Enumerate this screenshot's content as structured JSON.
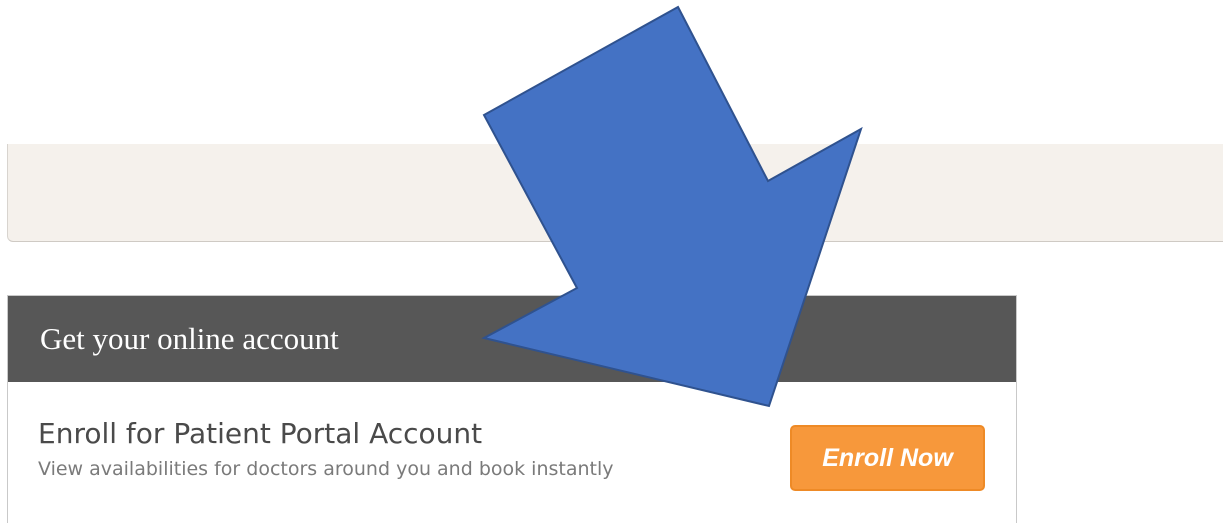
{
  "card": {
    "title": "Get your online account",
    "heading": "Enroll for Patient Portal Account",
    "subtitle": "View availabilities for doctors around you and book instantly",
    "button_label": "Enroll Now"
  },
  "annotation": {
    "icon": "arrow-down-right-icon",
    "color": "#4472c4"
  },
  "colors": {
    "header_background": "#575757",
    "button_background": "#f7983b",
    "top_panel_background": "#f5f1ec"
  }
}
